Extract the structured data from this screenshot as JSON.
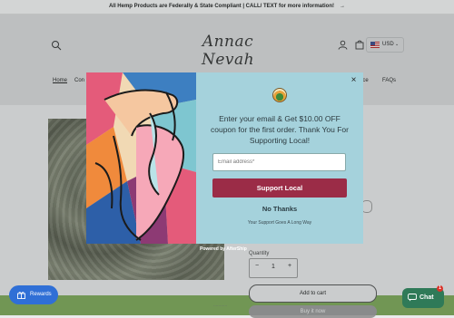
{
  "announcement": {
    "text": "All Hemp Products are Federally & State Compliant | CALL/ TEXT for more information!",
    "arrow": "→"
  },
  "header": {
    "logo_text": "Annac Nevah",
    "currency": {
      "code": "USD",
      "caret": "⌄"
    },
    "nav": {
      "home": "Home",
      "partial_left": "Con",
      "partial_right": "ice",
      "faqs": "FAQs"
    }
  },
  "product": {
    "quantity_label": "Quantity",
    "quantity_value": "1",
    "minus": "−",
    "plus": "+",
    "add_to_cart": "Add to cart",
    "buy_now": "Buy it now",
    "small_text": "..........."
  },
  "popup": {
    "headline": "Enter your email & Get $10.00 OFF coupon for the first order. Thank You For Supporting Local!",
    "email_placeholder": "Email address*",
    "submit": "Support Local",
    "decline": "No Thanks",
    "note": "Your Support Goes A Long Way",
    "close": "×",
    "powered_by": "Powered by AfterShip"
  },
  "widgets": {
    "rewards": "Rewards",
    "chat": "Chat",
    "chat_badge": "1"
  },
  "colors": {
    "submit_bg": "#9b2c47",
    "panel_bg": "#a5d2dc",
    "rewards_bg": "#2f6fd6",
    "chat_bg": "#2f7a58"
  }
}
